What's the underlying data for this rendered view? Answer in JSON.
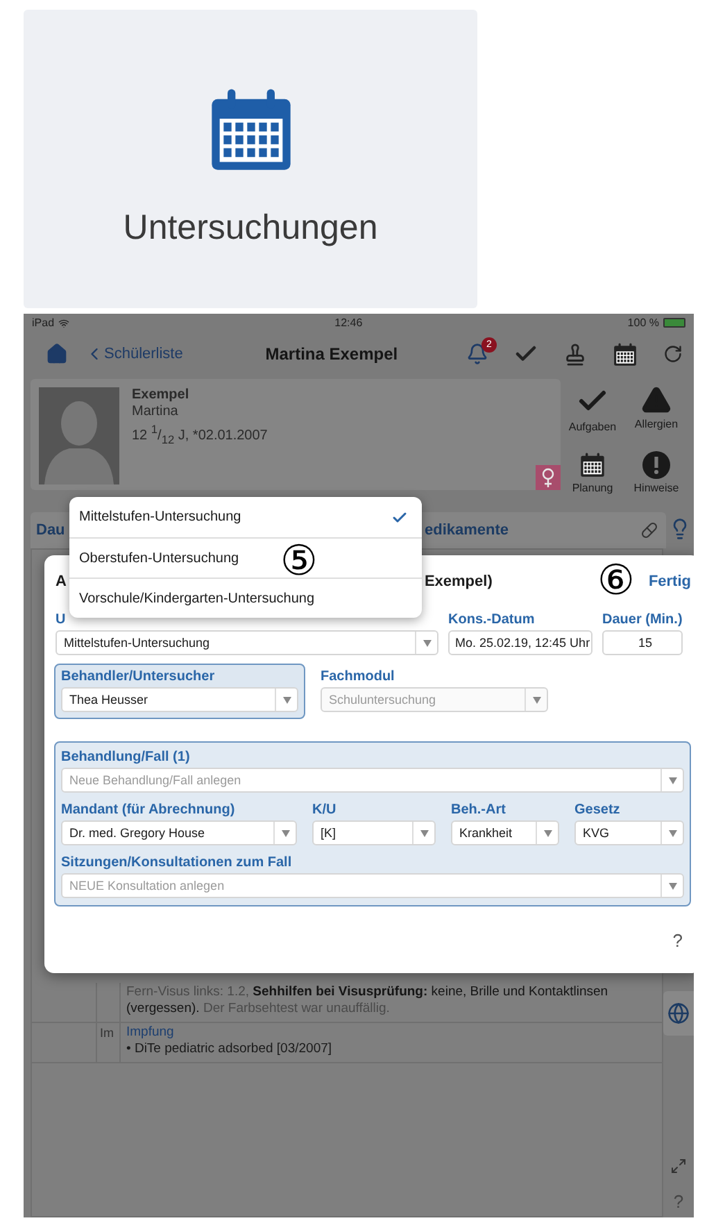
{
  "tile": {
    "label": "Untersuchungen"
  },
  "status_bar": {
    "device": "iPad",
    "time": "12:46",
    "battery": "100 %"
  },
  "nav": {
    "back": "Schülerliste",
    "title": "Martina Exempel",
    "notification_count": "2"
  },
  "patient": {
    "last_name": "Exempel",
    "first_name": "Martina",
    "age": "12 $^{1}$/$_{12}$ J, *02.01.2007"
  },
  "actions": [
    {
      "label": "Aufgaben",
      "kind": "check"
    },
    {
      "label": "Allergien",
      "kind": "warning"
    },
    {
      "label": "Planung",
      "kind": "calendar"
    },
    {
      "label": "Hinweise",
      "kind": "alert"
    }
  ],
  "tabs": [
    {
      "label": "Dau"
    },
    {
      "label": "edikamente"
    }
  ],
  "popover": {
    "annotation": "⑤",
    "options": [
      {
        "label": "Mittelstufen-Untersuchung",
        "selected": true
      },
      {
        "label": "Oberstufen-Untersuchung",
        "selected": false
      },
      {
        "label": "Vorschule/Kindergarten-Untersuchung",
        "selected": false
      }
    ]
  },
  "modal": {
    "title_fragments": [
      "A",
      "Exempel)"
    ],
    "annotation": "⑥",
    "done": "Fertig",
    "type": {
      "label": "U",
      "value": "Mittelstufen-Untersuchung"
    },
    "date": {
      "label": "Kons.-Datum",
      "value": "Mo. 25.02.19, 12:45 Uhr"
    },
    "duration": {
      "label": "Dauer (Min.)",
      "value": "15"
    },
    "examiner": {
      "label": "Behandler/Untersucher",
      "value": "Thea Heusser",
      "highlighted": true
    },
    "module": {
      "label": "Fachmodul",
      "value": "Schuluntersuchung",
      "disabled": true
    },
    "case": {
      "label": "Behandlung/Fall (1)",
      "placeholder": "Neue Behandlung/Fall anlegen",
      "fields": [
        {
          "label": "Mandant (für Abrechnung)",
          "value": "Dr. med. Gregory House"
        },
        {
          "label": "K/U",
          "value": "[K]"
        },
        {
          "label": "Beh.-Art",
          "value": "Krankheit"
        },
        {
          "label": "Gesetz",
          "value": "KVG"
        }
      ],
      "sessions_label": "Sitzungen/Konsultationen zum Fall",
      "sessions_placeholder": "NEUE Konsultation anlegen"
    },
    "help": "?"
  },
  "record": {
    "paragraph": [
      {
        "text": "Fern-Visus links: 1.2, ",
        "kind": "muted"
      },
      {
        "text": "Sehhilfen bei Visusprüfung:",
        "kind": "bold"
      },
      {
        "text": " keine, Brille und Kontaktlinsen (vergessen).",
        "kind": "plain"
      },
      {
        "text": " Der Farbsehtest war unauffällig.",
        "kind": "muted"
      }
    ],
    "entry": {
      "code": "Im",
      "title": "Impfung",
      "items": [
        "• DiTe pediatric adsorbed [03/2007]"
      ]
    }
  },
  "help": "?"
}
